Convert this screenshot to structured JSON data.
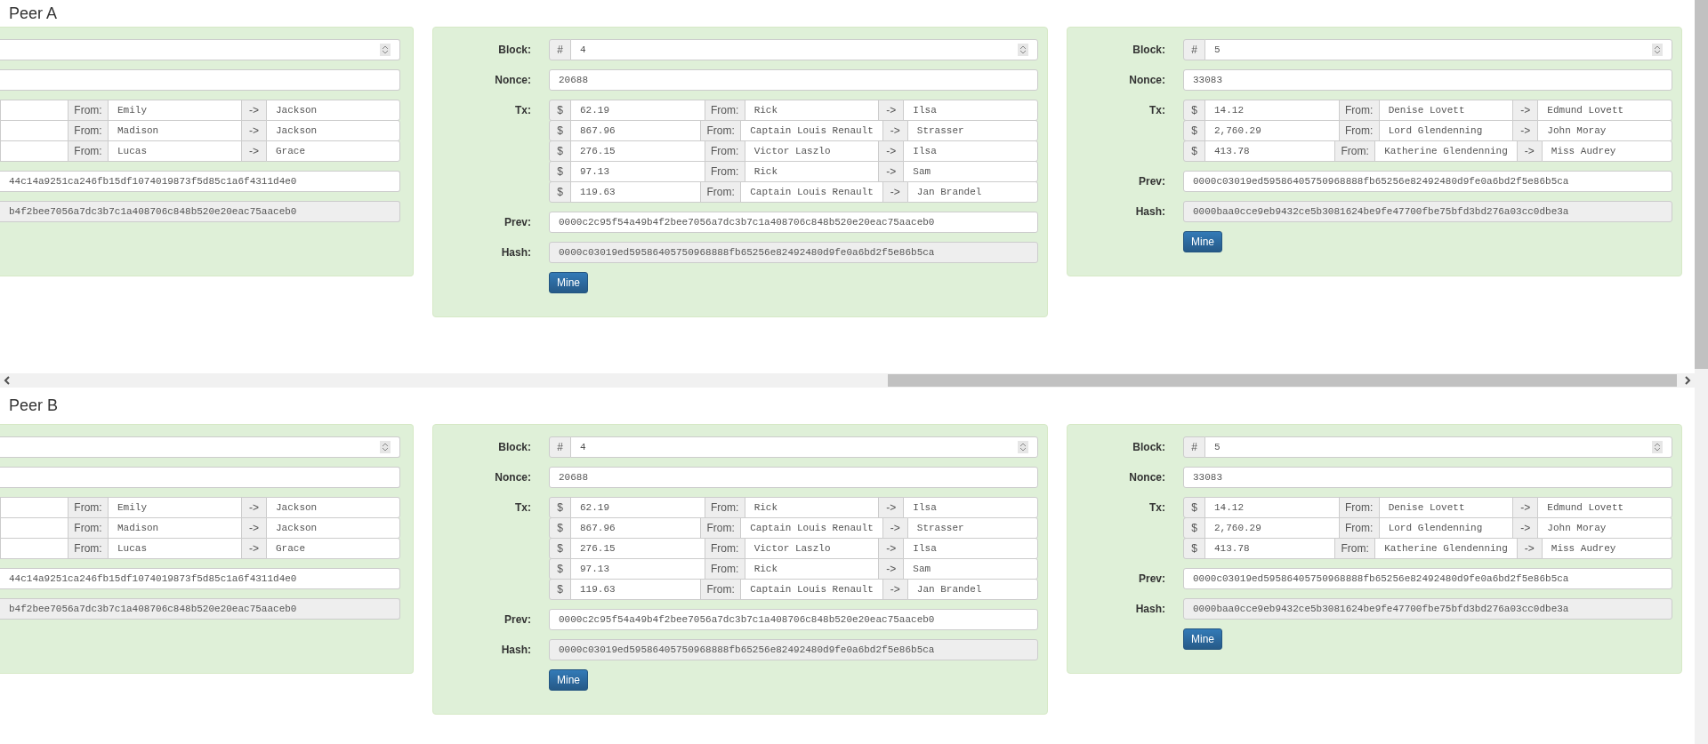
{
  "peers": [
    {
      "title": "Peer A",
      "blocks": [
        {
          "kind": "clipped",
          "txs": [
            {
              "from_label": "From:",
              "from": "Emily",
              "arrow": "->",
              "to": "Jackson"
            },
            {
              "from_label": "From:",
              "from": "Madison",
              "arrow": "->",
              "to": "Jackson"
            },
            {
              "from_label": "From:",
              "from": "Lucas",
              "arrow": "->",
              "to": "Grace"
            }
          ],
          "prev": "44c14a9251ca246fb15df1074019873f5d85c1a6f4311d4e0",
          "hash": "b4f2bee7056a7dc3b7c1a408706c848b520e20eac75aaceb0"
        },
        {
          "kind": "full",
          "block_label": "Block:",
          "block_prefix": "#",
          "block": "4",
          "nonce_label": "Nonce:",
          "nonce": "20688",
          "tx_label": "Tx:",
          "txs": [
            {
              "currency": "$",
              "amount": "62.19",
              "from_label": "From:",
              "from": "Rick",
              "arrow": "->",
              "to": "Ilsa"
            },
            {
              "currency": "$",
              "amount": "867.96",
              "from_label": "From:",
              "from": "Captain Louis Renault",
              "arrow": "->",
              "to": "Strasser"
            },
            {
              "currency": "$",
              "amount": "276.15",
              "from_label": "From:",
              "from": "Victor Laszlo",
              "arrow": "->",
              "to": "Ilsa"
            },
            {
              "currency": "$",
              "amount": "97.13",
              "from_label": "From:",
              "from": "Rick",
              "arrow": "->",
              "to": "Sam"
            },
            {
              "currency": "$",
              "amount": "119.63",
              "from_label": "From:",
              "from": "Captain Louis Renault",
              "arrow": "->",
              "to": "Jan Brandel"
            }
          ],
          "prev_label": "Prev:",
          "prev": "0000c2c95f54a49b4f2bee7056a7dc3b7c1a408706c848b520e20eac75aaceb0",
          "hash_label": "Hash:",
          "hash": "0000c03019ed59586405750968888fb65256e82492480d9fe0a6bd2f5e86b5ca",
          "button": "Mine"
        },
        {
          "kind": "full",
          "block_label": "Block:",
          "block_prefix": "#",
          "block": "5",
          "nonce_label": "Nonce:",
          "nonce": "33083",
          "tx_label": "Tx:",
          "txs": [
            {
              "currency": "$",
              "amount": "14.12",
              "from_label": "From:",
              "from": "Denise Lovett",
              "arrow": "->",
              "to": "Edmund Lovett"
            },
            {
              "currency": "$",
              "amount": "2,760.29",
              "from_label": "From:",
              "from": "Lord Glendenning",
              "arrow": "->",
              "to": "John Moray"
            },
            {
              "currency": "$",
              "amount": "413.78",
              "from_label": "From:",
              "from": "Katherine Glendenning",
              "arrow": "->",
              "to": "Miss Audrey"
            }
          ],
          "prev_label": "Prev:",
          "prev": "0000c03019ed59586405750968888fb65256e82492480d9fe0a6bd2f5e86b5ca",
          "hash_label": "Hash:",
          "hash": "0000baa0cce9eb9432ce5b3081624be9fe47700fbe75bfd3bd276a03cc0dbe3a",
          "button": "Mine"
        }
      ]
    },
    {
      "title": "Peer B",
      "blocks": [
        {
          "kind": "clipped",
          "txs": [
            {
              "from_label": "From:",
              "from": "Emily",
              "arrow": "->",
              "to": "Jackson"
            },
            {
              "from_label": "From:",
              "from": "Madison",
              "arrow": "->",
              "to": "Jackson"
            },
            {
              "from_label": "From:",
              "from": "Lucas",
              "arrow": "->",
              "to": "Grace"
            }
          ],
          "prev": "44c14a9251ca246fb15df1074019873f5d85c1a6f4311d4e0",
          "hash": "b4f2bee7056a7dc3b7c1a408706c848b520e20eac75aaceb0"
        },
        {
          "kind": "full",
          "block_label": "Block:",
          "block_prefix": "#",
          "block": "4",
          "nonce_label": "Nonce:",
          "nonce": "20688",
          "tx_label": "Tx:",
          "txs": [
            {
              "currency": "$",
              "amount": "62.19",
              "from_label": "From:",
              "from": "Rick",
              "arrow": "->",
              "to": "Ilsa"
            },
            {
              "currency": "$",
              "amount": "867.96",
              "from_label": "From:",
              "from": "Captain Louis Renault",
              "arrow": "->",
              "to": "Strasser"
            },
            {
              "currency": "$",
              "amount": "276.15",
              "from_label": "From:",
              "from": "Victor Laszlo",
              "arrow": "->",
              "to": "Ilsa"
            },
            {
              "currency": "$",
              "amount": "97.13",
              "from_label": "From:",
              "from": "Rick",
              "arrow": "->",
              "to": "Sam"
            },
            {
              "currency": "$",
              "amount": "119.63",
              "from_label": "From:",
              "from": "Captain Louis Renault",
              "arrow": "->",
              "to": "Jan Brandel"
            }
          ],
          "prev_label": "Prev:",
          "prev": "0000c2c95f54a49b4f2bee7056a7dc3b7c1a408706c848b520e20eac75aaceb0",
          "hash_label": "Hash:",
          "hash": "0000c03019ed59586405750968888fb65256e82492480d9fe0a6bd2f5e86b5ca",
          "button": "Mine"
        },
        {
          "kind": "full",
          "block_label": "Block:",
          "block_prefix": "#",
          "block": "5",
          "nonce_label": "Nonce:",
          "nonce": "33083",
          "tx_label": "Tx:",
          "txs": [
            {
              "currency": "$",
              "amount": "14.12",
              "from_label": "From:",
              "from": "Denise Lovett",
              "arrow": "->",
              "to": "Edmund Lovett"
            },
            {
              "currency": "$",
              "amount": "2,760.29",
              "from_label": "From:",
              "from": "Lord Glendenning",
              "arrow": "->",
              "to": "John Moray"
            },
            {
              "currency": "$",
              "amount": "413.78",
              "from_label": "From:",
              "from": "Katherine Glendenning",
              "arrow": "->",
              "to": "Miss Audrey"
            }
          ],
          "prev_label": "Prev:",
          "prev": "0000c03019ed59586405750968888fb65256e82492480d9fe0a6bd2f5e86b5ca",
          "hash_label": "Hash:",
          "hash": "0000baa0cce9eb9432ce5b3081624be9fe47700fbe75bfd3bd276a03cc0dbe3a",
          "button": "Mine"
        }
      ]
    }
  ]
}
